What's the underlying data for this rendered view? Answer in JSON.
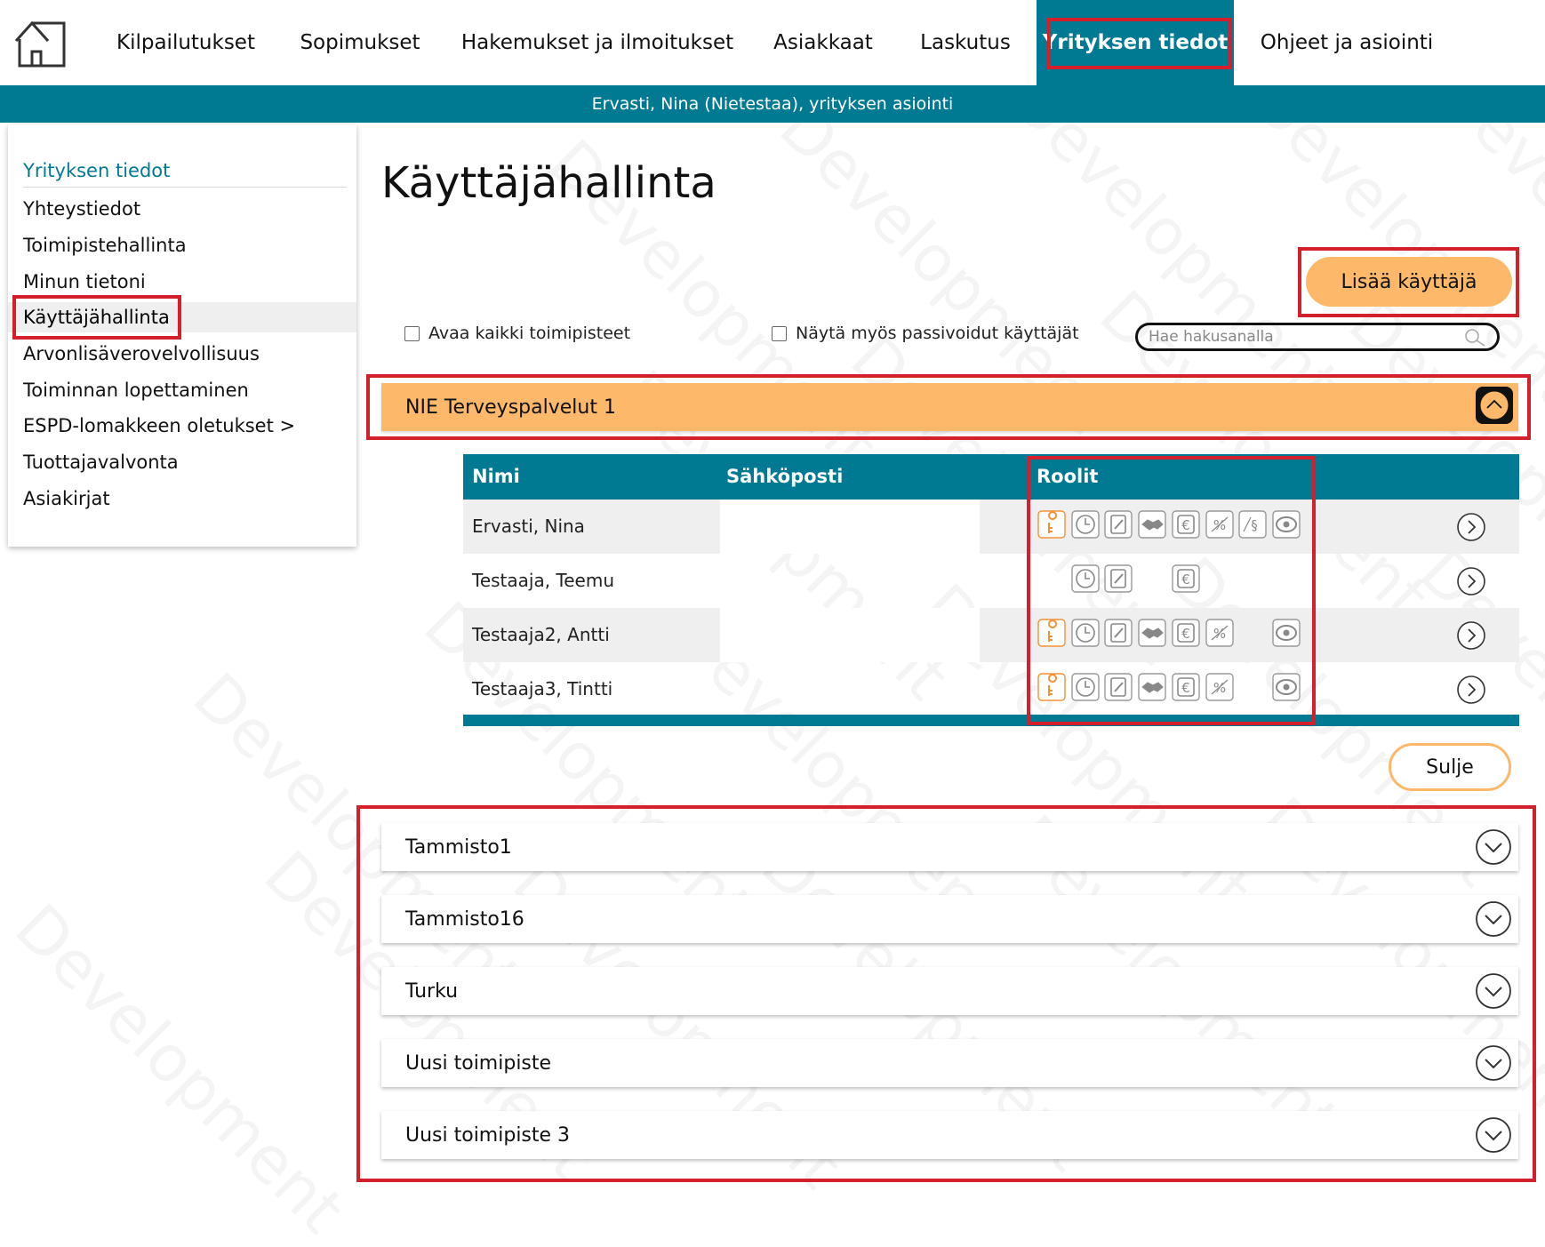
{
  "nav": {
    "home": "home-icon",
    "items": [
      {
        "label": "Kilpailutukset"
      },
      {
        "label": "Sopimukset"
      },
      {
        "label": "Hakemukset ja ilmoitukset"
      },
      {
        "label": "Asiakkaat"
      },
      {
        "label": "Laskutus"
      },
      {
        "label": "Yrityksen tiedot",
        "active": true
      },
      {
        "label": "Ohjeet ja asiointi"
      }
    ]
  },
  "userbar": {
    "text": "Ervasti, Nina (Nietestaa), yrityksen asiointi"
  },
  "sidebar": {
    "heading": "Yrityksen tiedot",
    "items": [
      {
        "label": "Yhteystiedot"
      },
      {
        "label": "Toimipistehallinta"
      },
      {
        "label": "Minun tietoni"
      },
      {
        "label": "Käyttäjähallinta",
        "active": true
      },
      {
        "label": "Arvonlisäverovelvollisuus"
      },
      {
        "label": "Toiminnan lopettaminen"
      },
      {
        "label": "ESPD-lomakkeen oletukset >"
      },
      {
        "label": "Tuottajavalvonta"
      },
      {
        "label": "Asiakirjat"
      }
    ]
  },
  "main": {
    "title": "Käyttäjähallinta",
    "add_user_label": "Lisää käyttäjä",
    "filters": {
      "open_all": "Avaa kaikki toimipisteet",
      "show_passive": "Näytä myös passivoidut käyttäjät"
    },
    "search": {
      "placeholder": "Hae hakusanalla"
    },
    "open_office": {
      "name": "NIE Terveyspalvelut 1",
      "columns": {
        "name": "Nimi",
        "email": "Sähköposti",
        "roles": "Roolit"
      },
      "users": [
        {
          "name": "Ervasti, Nina",
          "roles": [
            "key",
            "clock",
            "edit",
            "handshake",
            "euro",
            "percent",
            "paragraph",
            "eye"
          ]
        },
        {
          "name": "Testaaja, Teemu",
          "roles": [
            "clock",
            "edit",
            "euro"
          ]
        },
        {
          "name": "Testaaja2, Antti",
          "roles": [
            "key",
            "clock",
            "edit",
            "handshake",
            "euro",
            "percent",
            "eye"
          ]
        },
        {
          "name": "Testaaja3, Tintti",
          "roles": [
            "key",
            "clock",
            "edit",
            "handshake",
            "euro",
            "percent",
            "eye"
          ]
        }
      ]
    },
    "close_label": "Sulje",
    "offices": [
      {
        "name": "Tammisto1"
      },
      {
        "name": "Tammisto16"
      },
      {
        "name": "Turku"
      },
      {
        "name": "Uusi toimipiste"
      },
      {
        "name": "Uusi toimipiste 3"
      }
    ]
  },
  "watermark": "Development",
  "colors": {
    "teal": "#007a93",
    "orange": "#fdb86a",
    "key_orange": "#f39235",
    "highlight": "#d41f2c"
  }
}
